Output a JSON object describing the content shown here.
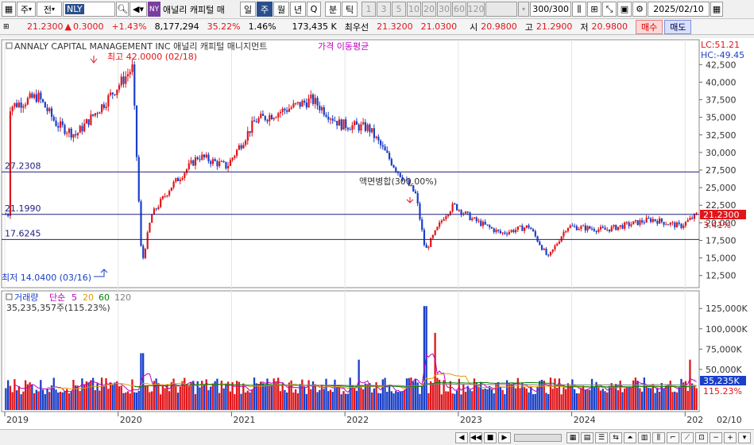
{
  "toolbar": {
    "market": "주",
    "market_type": "전",
    "ticker": "NLY",
    "exchange_badge": "NY",
    "stock_name": "애널리 캐피털 매",
    "periods": [
      "일",
      "주",
      "월",
      "년",
      "Q"
    ],
    "active_period": "주",
    "minute_buttons": [
      "분",
      "틱",
      "1",
      "3",
      "5",
      "10",
      "20",
      "30",
      "60",
      "120"
    ],
    "count": "300",
    "count_total": "/300",
    "date": "2025/02/10"
  },
  "quote": {
    "price": "21.2300",
    "change_arrow": "▲",
    "change": "0.3000",
    "change_pct": "+1.43%",
    "volume": "8,177,294",
    "turnover_pct": "35.22%",
    "other_pct": "1.46%",
    "amount": "173,435 K",
    "pref_label": "최우선",
    "bid": "21.3200",
    "ask": "21.0300",
    "open_label": "시",
    "open": "20.9800",
    "high_label": "고",
    "high": "21.2900",
    "low_label": "저",
    "low": "20.9800",
    "buy_label": "매수",
    "sell_label": "매도"
  },
  "price_panel": {
    "title": "ANNALY CAPITAL MANAGEMENT INC  애널리 캐피털 매니지먼트",
    "indicator_label": "가격 이동평균",
    "lc": "LC:51.21",
    "hc": "HC:-49.45",
    "high_marker": "최고 42.0000 (02/18)",
    "low_marker": "최저 14.0400 (03/16)",
    "event_label": "액면병합(300.00%)",
    "lines": [
      {
        "label": "27.2308",
        "value": 27.2308
      },
      {
        "label": "21.1990",
        "value": 21.199
      },
      {
        "label": "17.6245",
        "value": 17.6245
      }
    ],
    "last_price_tag": "21.2300",
    "last_pct_tag": "3.41%",
    "y_ticks": [
      "42,500",
      "40,000",
      "37,500",
      "35,000",
      "32,500",
      "30,000",
      "27,500",
      "25,000",
      "22,500",
      "20,000",
      "17,500",
      "15,000",
      "12,500"
    ]
  },
  "volume_panel": {
    "title": "거래량",
    "ma_label": "단순",
    "ma_periods": [
      "5",
      "20",
      "60",
      "120"
    ],
    "summary": "35,235,357주(115.23%)",
    "last_tag": "35,235K",
    "last_pct_tag": "115.23%",
    "y_ticks": [
      "125,000K",
      "100,000K",
      "75,000K",
      "50,000K"
    ]
  },
  "x_axis": {
    "labels": [
      "2019",
      "2020",
      "2021",
      "2022",
      "2023",
      "2024",
      "202"
    ],
    "end_label": "02/10"
  },
  "colors": {
    "up": "#e0161b",
    "down": "#1a3fc8",
    "ma5": "#c000c0",
    "ma20": "#e0a000",
    "ma60": "#008000",
    "ma120": "#808080"
  },
  "chart_data": {
    "type": "candlestick",
    "interval": "weekly",
    "x_range": [
      "2019-01",
      "2025-02-10"
    ],
    "ylim": [
      11000,
      44000
    ],
    "anchor_series": [
      {
        "date": "2019-01",
        "close": 36500
      },
      {
        "date": "2019-04",
        "close": 38000
      },
      {
        "date": "2019-06",
        "close": 34000
      },
      {
        "date": "2019-08",
        "close": 32500
      },
      {
        "date": "2019-11",
        "close": 37000
      },
      {
        "date": "2020-02",
        "close": 42000
      },
      {
        "date": "2020-03",
        "close": 14040
      },
      {
        "date": "2020-04",
        "close": 21000
      },
      {
        "date": "2020-06",
        "close": 25000
      },
      {
        "date": "2020-09",
        "close": 29500
      },
      {
        "date": "2020-12",
        "close": 28000
      },
      {
        "date": "2021-03",
        "close": 34500
      },
      {
        "date": "2021-06",
        "close": 36000
      },
      {
        "date": "2021-09",
        "close": 37500
      },
      {
        "date": "2021-12",
        "close": 34000
      },
      {
        "date": "2022-03",
        "close": 33500
      },
      {
        "date": "2022-06",
        "close": 27500
      },
      {
        "date": "2022-08",
        "close": 24000
      },
      {
        "date": "2022-09",
        "close": 16000
      },
      {
        "date": "2022-11",
        "close": 21000
      },
      {
        "date": "2022-12",
        "close": 22500
      },
      {
        "date": "2023-02",
        "close": 20500
      },
      {
        "date": "2023-05",
        "close": 18500
      },
      {
        "date": "2023-08",
        "close": 19500
      },
      {
        "date": "2023-10",
        "close": 15000
      },
      {
        "date": "2023-12",
        "close": 19500
      },
      {
        "date": "2024-04",
        "close": 19000
      },
      {
        "date": "2024-09",
        "close": 20500
      },
      {
        "date": "2024-12",
        "close": 19500
      },
      {
        "date": "2025-02-10",
        "close": 21230
      }
    ],
    "horizontal_levels": [
      27.2308,
      21.199,
      17.6245
    ],
    "volume_ylim": [
      0,
      135000
    ],
    "volume_spikes": [
      {
        "date": "2020-03",
        "value": 70000
      },
      {
        "date": "2022-02",
        "value": 62000
      },
      {
        "date": "2022-09",
        "value": 128000
      },
      {
        "date": "2022-10",
        "value": 95000
      },
      {
        "date": "2025-01",
        "value": 62000
      }
    ],
    "volume_baseline": 35000
  }
}
